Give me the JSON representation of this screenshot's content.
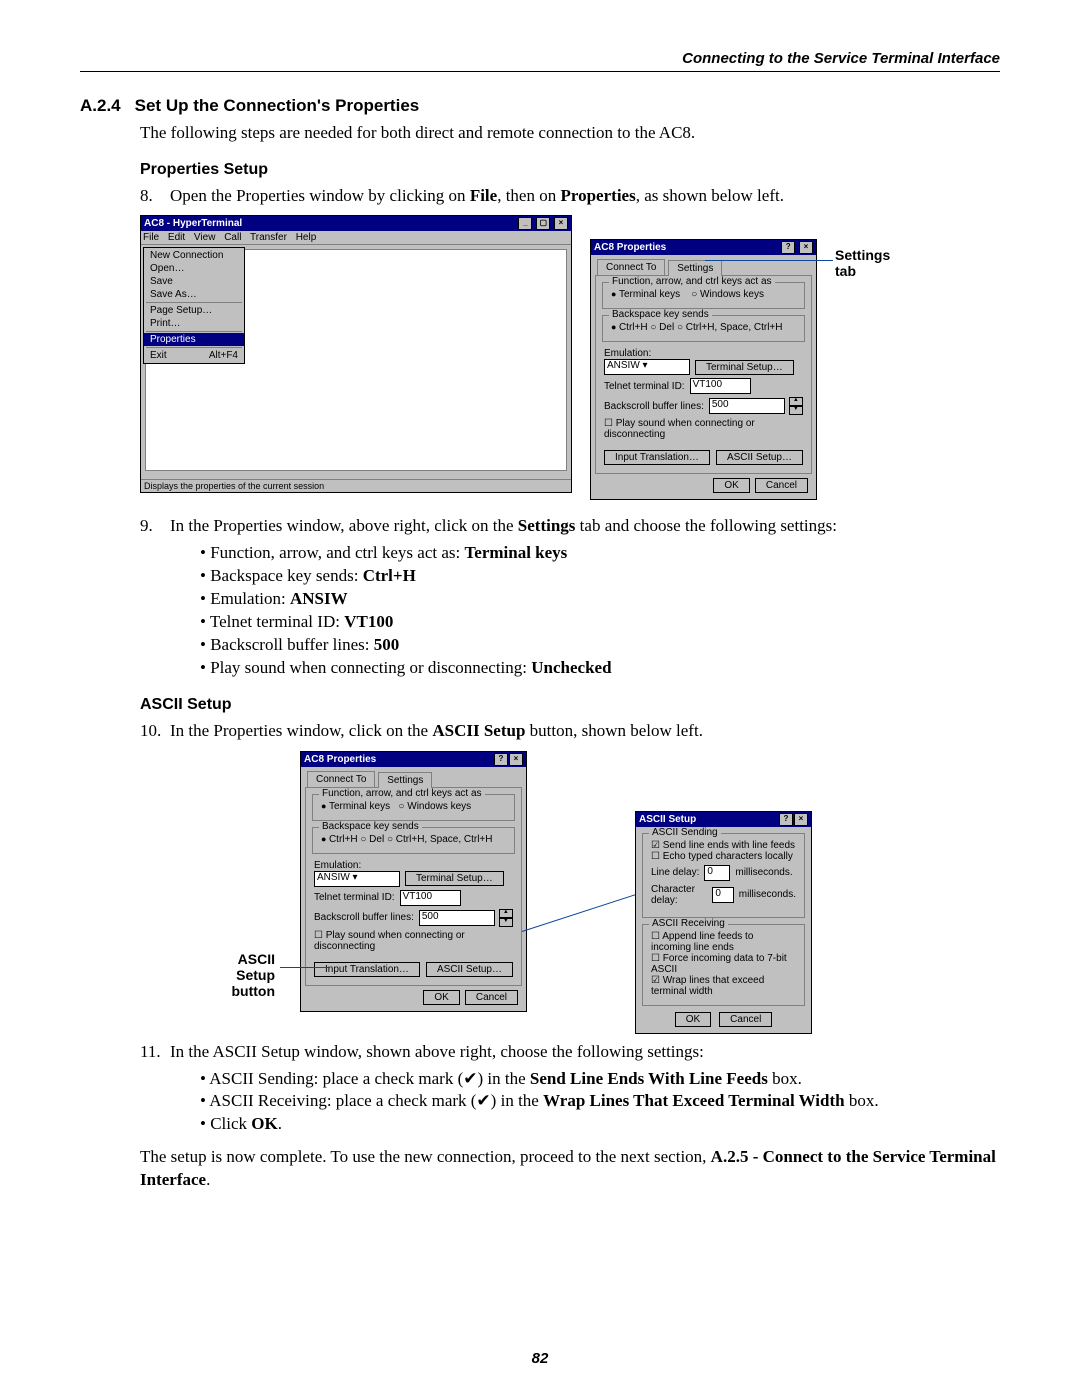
{
  "header": {
    "running": "Connecting to the Service Terminal Interface"
  },
  "sec": {
    "num": "A.2.4",
    "title": "Set Up the Connection's Properties"
  },
  "intro": "The following steps are needed for both direct and remote connection to the AC8.",
  "propSetup": {
    "heading": "Properties Setup",
    "step8_num": "8.",
    "step8_a": "Open the Properties window by clicking on ",
    "step8_b": "File",
    "step8_c": ", then on ",
    "step8_d": "Properties",
    "step8_e": ", as shown below left.",
    "step9_num": "9.",
    "step9_a": "In the Properties window, above right, click on the ",
    "step9_b": "Settings",
    "step9_c": " tab and choose the following settings:",
    "b1a": "Function, arrow, and ctrl keys act as: ",
    "b1b": "Terminal keys",
    "b2a": "Backspace key sends: ",
    "b2b": "Ctrl+H",
    "b3a": "Emulation: ",
    "b3b": "ANSIW",
    "b4a": "Telnet terminal ID: ",
    "b4b": "VT100",
    "b5a": "Backscroll buffer lines: ",
    "b5b": "500",
    "b6a": "Play sound when connecting or disconnecting: ",
    "b6b": "Unchecked"
  },
  "asciiSetup": {
    "heading": "ASCII Setup",
    "step10_num": "10.",
    "step10_a": "In the Properties window, click on the ",
    "step10_b": "ASCII Setup",
    "step10_c": " button, shown below left.",
    "step11_num": "11.",
    "step11_a": "In the ASCII Setup window, shown above right, choose the following settings:",
    "b1a": "ASCII Sending: place a check mark (✔) in the ",
    "b1b": "Send Line Ends With Line Feeds",
    "b1c": " box.",
    "b2a": "ASCII Receiving: place a check mark (✔) in the ",
    "b2b": "Wrap Lines That Exceed Terminal Width",
    "b2c": " box.",
    "b3a": "Click ",
    "b3b": "OK",
    "b3c": "."
  },
  "closing_a": "The setup is now complete. To use the new connection, proceed to the next section, ",
  "closing_b": "A.2.5 - Connect to the Service Terminal Interface",
  "closing_c": ".",
  "pageNum": "82",
  "callouts": {
    "settingsTab": "Settings tab",
    "asciiBtn": "ASCII Setup button"
  },
  "hyper": {
    "title": "AC8 - HyperTerminal",
    "menus": [
      "File",
      "Edit",
      "View",
      "Call",
      "Transfer",
      "Help"
    ],
    "file": {
      "new": "New Connection",
      "open": "Open…",
      "save": "Save",
      "saveAs": "Save As…",
      "pageSetup": "Page Setup…",
      "print": "Print…",
      "props": "Properties",
      "exit": "Exit",
      "exitK": "Alt+F4"
    },
    "status": "Displays the properties of the current session"
  },
  "props": {
    "title": "AC8 Properties",
    "tab1": "Connect To",
    "tab2": "Settings",
    "grp1": "Function, arrow, and ctrl keys act as",
    "r11": "Terminal keys",
    "r12": "Windows keys",
    "grp2": "Backspace key sends",
    "r21": "Ctrl+H",
    "r22": "Del",
    "r23": "Ctrl+H, Space, Ctrl+H",
    "emulLbl": "Emulation:",
    "emulVal": "ANSIW",
    "termSetup": "Terminal Setup…",
    "telnetLbl": "Telnet terminal ID:",
    "telnetVal": "VT100",
    "backLbl": "Backscroll buffer lines:",
    "backVal": "500",
    "playSound": "Play sound when connecting or disconnecting",
    "inputTrans": "Input Translation…",
    "asciiSetup": "ASCII Setup…",
    "ok": "OK",
    "cancel": "Cancel"
  },
  "ascii": {
    "title": "ASCII Setup",
    "grp1": "ASCII Sending",
    "c11": "Send line ends with line feeds",
    "c12": "Echo typed characters locally",
    "lineLbl": "Line delay:",
    "lineVal": "0",
    "lineUnit": "milliseconds.",
    "charLbl": "Character delay:",
    "charVal": "0",
    "charUnit": "milliseconds.",
    "grp2": "ASCII Receiving",
    "c21": "Append line feeds to incoming line ends",
    "c22": "Force incoming data to 7-bit ASCII",
    "c23": "Wrap lines that exceed terminal width",
    "ok": "OK",
    "cancel": "Cancel"
  }
}
